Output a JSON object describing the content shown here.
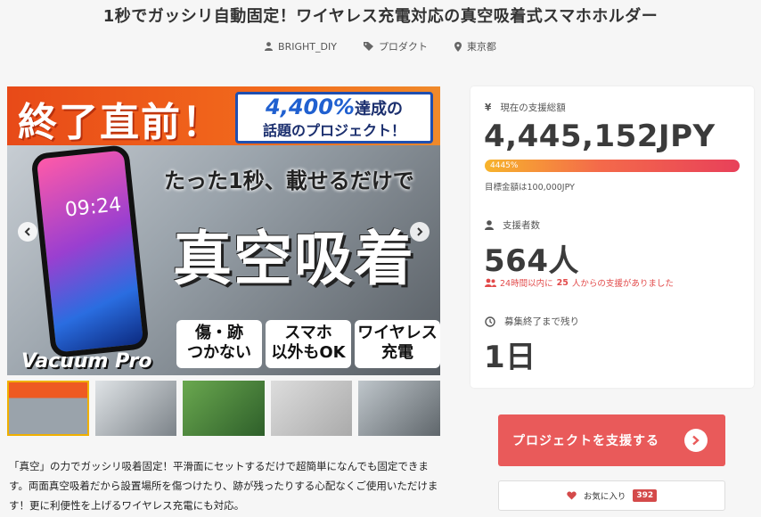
{
  "page": {
    "title": "1秒でガッシリ自動固定！ワイヤレス充電対応の真空吸着式スマホホルダー",
    "meta": {
      "author": "BRIGHT_DIY",
      "category": "プロダクト",
      "location": "東京都"
    }
  },
  "hero": {
    "title": "終了直前！",
    "badge_number": "4,400%",
    "badge_suffix": "達成の",
    "badge_sub": "話題のプロジェクト！",
    "phone_time": "09:24",
    "subtitle": "たった1秒、載せるだけで",
    "main_text": "真空吸着",
    "features": [
      "傷・跡\nつかない",
      "スマホ\n以外もOK",
      "ワイヤレス\n充電"
    ],
    "product_name": "Vacuum Pro"
  },
  "thumbnails": 5,
  "description": "「真空」の力でガッシリ吸着固定！平滑面にセットするだけで超簡単になんでも固定できます。両面真空吸着だから設置場所を傷つけたり、跡が残ったりする心配なくご使用いただけます！更に利便性を上げるワイヤレス充電にも対応。",
  "stats": {
    "total_label": "現在の支援総額",
    "total_value": "4,445,152JPY",
    "progress_text": "4445%",
    "progress_fraction": 1.0,
    "goal_text": "目標金額は100,000JPY",
    "backers_label": "支援者数",
    "backers_value": "564人",
    "recent_prefix": "24時間以内に",
    "recent_count": "25",
    "recent_suffix": "人からの支援がありました",
    "remaining_label": "募集終了まで残り",
    "remaining_value": "1日"
  },
  "actions": {
    "support_label": "プロジェクトを支援する",
    "favorite_label": "お気に入り",
    "favorite_count": "392"
  },
  "colors": {
    "accent": "#e95a5a",
    "favorite_badge": "#d44a4a"
  }
}
